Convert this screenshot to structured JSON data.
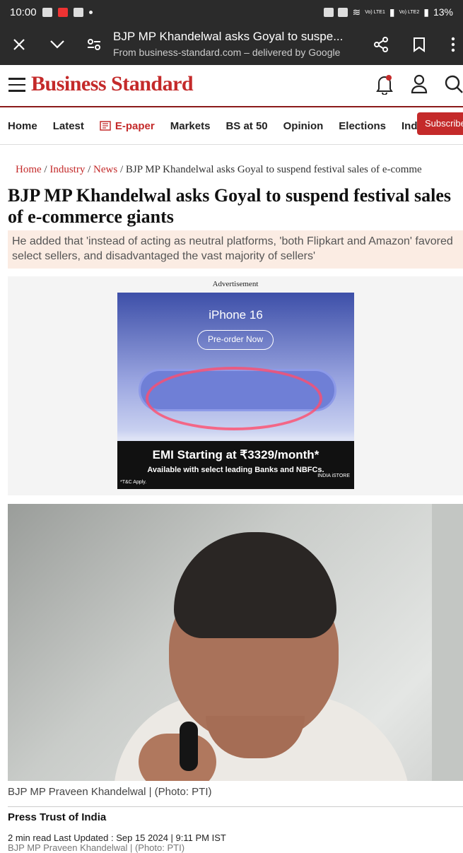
{
  "status_bar": {
    "time": "10:00",
    "battery": "13%",
    "signal1": "Vo) LTE1",
    "signal2": "Vo) LTE2"
  },
  "custom_tab": {
    "title": "BJP MP Khandelwal asks Goyal to suspe...",
    "subtitle": "From business-standard.com – delivered by Google"
  },
  "site": {
    "logo": "Business Standard"
  },
  "nav": {
    "items": [
      "Home",
      "Latest",
      "E-paper",
      "Markets",
      "BS at 50",
      "Opinion",
      "Elections",
      "India"
    ],
    "subscribe": "Subscribe"
  },
  "breadcrumb": {
    "home": "Home",
    "industry": "Industry",
    "news": "News",
    "sep": "/",
    "current": "BJP MP Khandelwal asks Goyal to suspend festival sales of e-comme"
  },
  "article": {
    "headline": "BJP MP Khandelwal asks Goyal to suspend festival sales of e-commerce giants",
    "summary": "He added that 'instead of acting as neutral platforms, 'both Flipkart and Amazon' favored select sellers, and disadvantaged the vast majority of sellers'",
    "photo_caption": "BJP MP Praveen Khandelwal | (Photo: PTI)",
    "byline": "Press Trust of India",
    "updated": "2 min read Last Updated : Sep 15 2024 | 9:11 PM IST",
    "ghost_caption": "BJP MP Praveen Khandelwal | (Photo: PTI)"
  },
  "ad": {
    "label": "Advertisement",
    "title": "iPhone 16",
    "button": "Pre-order Now",
    "emi": "EMI Starting at ₹3329/month*",
    "emi_sub": "Available with select leading Banks and NBFCs.",
    "tc": "*T&C Apply.",
    "store": "INDIA iSTORE"
  }
}
